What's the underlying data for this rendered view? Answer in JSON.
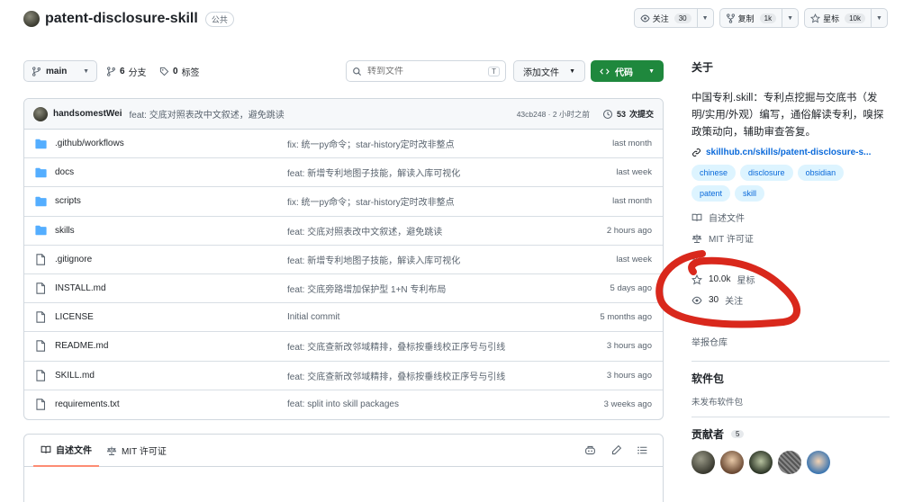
{
  "header": {
    "repo_name": "patent-disclosure-skill",
    "visibility": "公共",
    "watch": {
      "label": "关注",
      "count": "30"
    },
    "fork": {
      "label": "复制",
      "count": "1k"
    },
    "star": {
      "label": "星标",
      "count": "10k"
    }
  },
  "toolbar": {
    "branch": "main",
    "branches_count": "6",
    "branches_label": "分支",
    "tags_count": "0",
    "tags_label": "标签",
    "search_placeholder": "转到文件",
    "search_shortcut": "T",
    "add_file_label": "添加文件",
    "code_label": "代码"
  },
  "commit": {
    "author": "handsomestWei",
    "message": "feat: 交底对照表改中文叙述，避免跳读",
    "hash_time": "43cb248 · 2 小时之前",
    "commits_count": "53",
    "commits_label": "次提交"
  },
  "files": [
    {
      "name": ".github/workflows",
      "type": "folder",
      "message": "fix: 统一py命令；star-history定时改非整点",
      "date": "last month"
    },
    {
      "name": "docs",
      "type": "folder",
      "message": "feat: 新增专利地图子技能，解读入库可视化",
      "date": "last week"
    },
    {
      "name": "scripts",
      "type": "folder",
      "message": "fix: 统一py命令；star-history定时改非整点",
      "date": "last month"
    },
    {
      "name": "skills",
      "type": "folder",
      "message": "feat: 交底对照表改中文叙述，避免跳读",
      "date": "2 hours ago"
    },
    {
      "name": ".gitignore",
      "type": "file",
      "message": "feat: 新增专利地图子技能，解读入库可视化",
      "date": "last week"
    },
    {
      "name": "INSTALL.md",
      "type": "file",
      "message": "feat: 交底旁路增加保护型 1+N 专利布局",
      "date": "5 days ago"
    },
    {
      "name": "LICENSE",
      "type": "file",
      "message": "Initial commit",
      "date": "5 months ago"
    },
    {
      "name": "README.md",
      "type": "file",
      "message": "feat: 交底查新改邻域精排，叠标按垂线校正序号与引线",
      "date": "3 hours ago"
    },
    {
      "name": "SKILL.md",
      "type": "file",
      "message": "feat: 交底查新改邻域精排，叠标按垂线校正序号与引线",
      "date": "3 hours ago"
    },
    {
      "name": "requirements.txt",
      "type": "file",
      "message": "feat: split into skill packages",
      "date": "3 weeks ago"
    }
  ],
  "readme_tabs": {
    "readme": "自述文件",
    "license": "MIT 许可证"
  },
  "about": {
    "heading": "关于",
    "description": "中国专利.skill：专利点挖掘与交底书（发明/实用/外观）编写，通俗解读专利，嗅探政策动向，辅助审查答复。",
    "link": "skillhub.cn/skills/patent-disclosure-s...",
    "topics": [
      "chinese",
      "disclosure",
      "obsidian",
      "patent",
      "skill"
    ],
    "readme_label": "自述文件",
    "license_label": "MIT 许可证",
    "stars_value": "10.0k",
    "stars_label": "星标",
    "watchers_value": "30",
    "watchers_label": "关注",
    "report_label": "举报仓库"
  },
  "packages": {
    "heading": "软件包",
    "empty_text": "未发布软件包"
  },
  "contributors": {
    "heading": "贡献者",
    "count": "5"
  },
  "colors": {
    "accent_green": "#1f883d",
    "link_blue": "#0969da",
    "folder_blue": "#54aeff",
    "annotation_red": "#d9281c"
  }
}
